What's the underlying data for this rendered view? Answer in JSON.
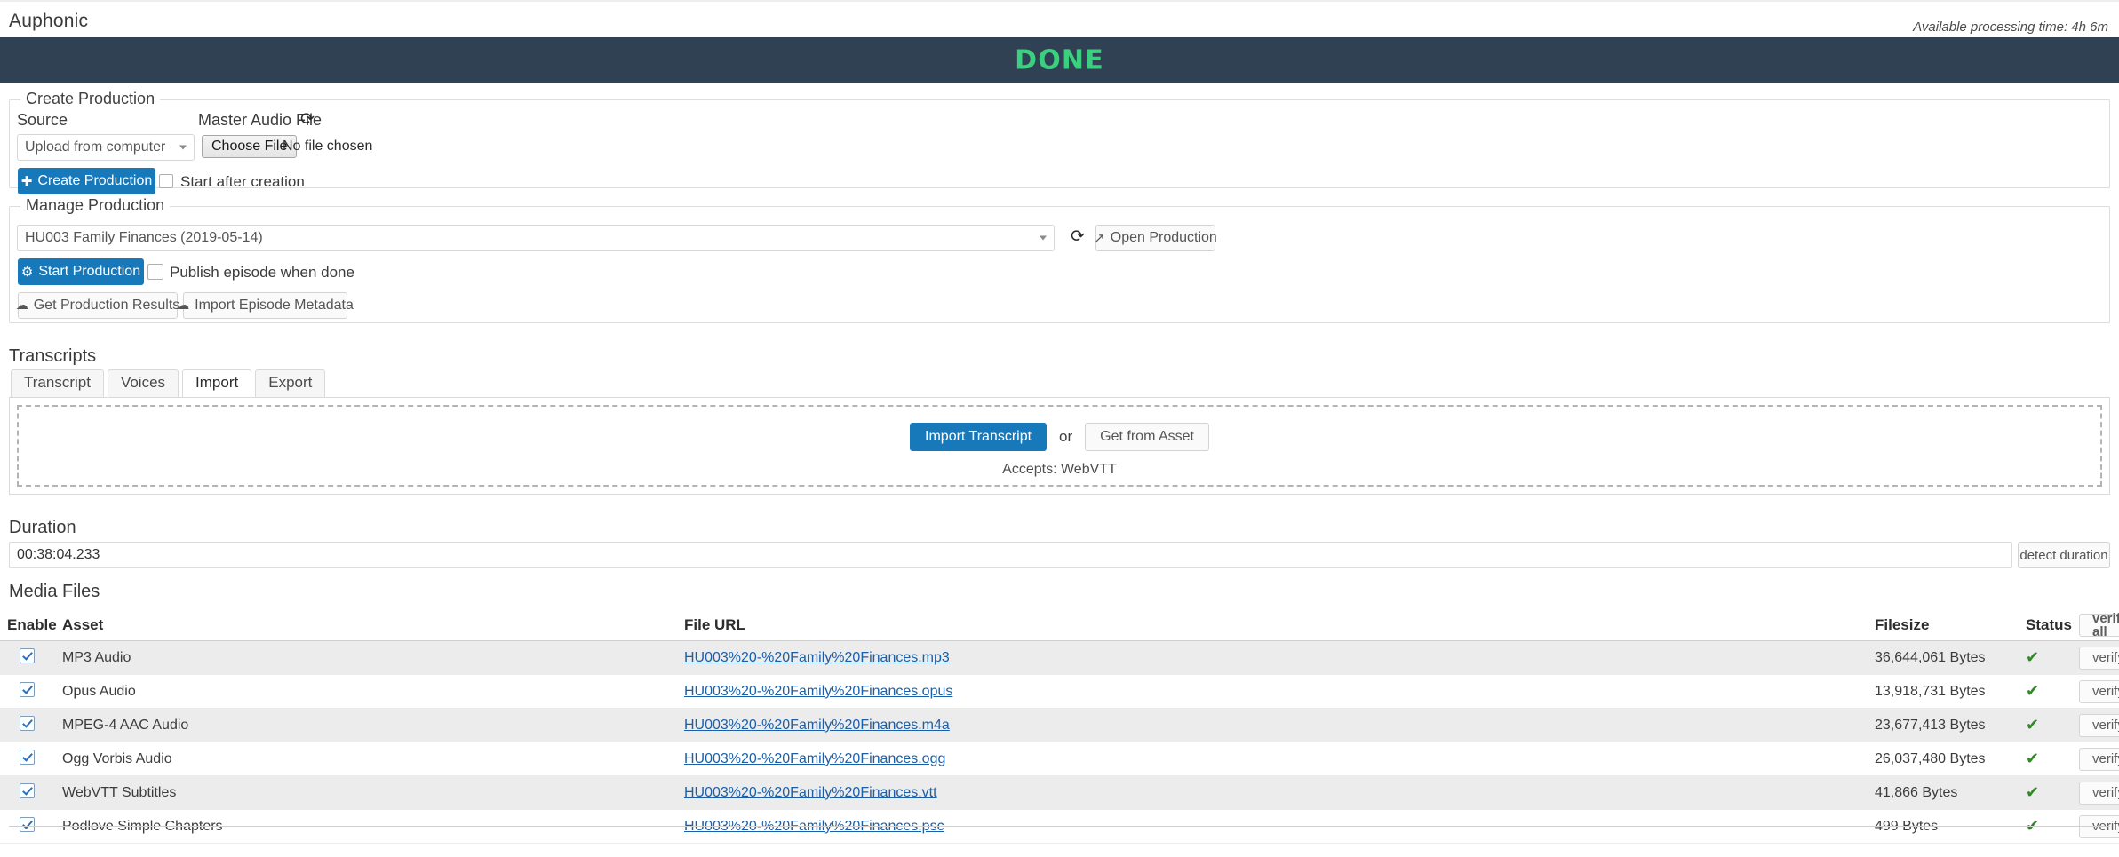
{
  "header": {
    "brand": "Auphonic",
    "processing_time": "Available processing time: 4h 6m",
    "status_banner": "DONE",
    "status_color": "#3ad07f",
    "banner_bg": "#2f4153"
  },
  "create_production": {
    "legend": "Create Production",
    "source_label": "Source",
    "source_value": "Upload from computer",
    "master_audio_label": "Master Audio File",
    "refresh_icon": "refresh-icon",
    "choose_file_label": "Choose File",
    "no_file_text": "No file chosen",
    "create_button": "Create Production",
    "create_button_icon": "plus-icon",
    "start_after_creation_label": "Start after creation",
    "start_after_creation_checked": false
  },
  "manage_production": {
    "legend": "Manage Production",
    "production_value": "HU003 Family Finances (2019-05-14)",
    "refresh_icon": "refresh-icon",
    "open_production_label": "Open Production",
    "open_production_icon": "external-link-icon",
    "start_production_label": "Start Production",
    "start_production_icon": "gears-icon",
    "publish_label": "Publish episode when done",
    "publish_checked": false,
    "get_results_label": "Get Production Results",
    "get_results_icon": "cloud-download-icon",
    "import_metadata_label": "Import Episode Metadata",
    "import_metadata_icon": "cloud-download-icon"
  },
  "transcripts": {
    "title": "Transcripts",
    "tabs": [
      {
        "label": "Transcript",
        "active": false
      },
      {
        "label": "Voices",
        "active": false
      },
      {
        "label": "Import",
        "active": true
      },
      {
        "label": "Export",
        "active": false
      }
    ],
    "import_button": "Import Transcript",
    "or_text": "or",
    "get_from_asset_button": "Get from Asset",
    "accepts_text": "Accepts: WebVTT"
  },
  "duration": {
    "title": "Duration",
    "value": "00:38:04.233",
    "detect_button": "detect duration"
  },
  "media_files": {
    "title": "Media Files",
    "verify_all_label": "verify all",
    "columns": [
      "Enable",
      "Asset",
      "File URL",
      "Filesize",
      "Status"
    ],
    "row_action_label": "verify",
    "status_icon": "check-icon",
    "rows": [
      {
        "enabled": true,
        "asset": "MP3 Audio",
        "url": "HU003%20-%20Family%20Finances.mp3",
        "filesize": "36,644,061 Bytes",
        "status": "✔"
      },
      {
        "enabled": true,
        "asset": "Opus Audio",
        "url": "HU003%20-%20Family%20Finances.opus",
        "filesize": "13,918,731 Bytes",
        "status": "✔"
      },
      {
        "enabled": true,
        "asset": "MPEG-4 AAC Audio",
        "url": "HU003%20-%20Family%20Finances.m4a",
        "filesize": "23,677,413 Bytes",
        "status": "✔"
      },
      {
        "enabled": true,
        "asset": "Ogg Vorbis Audio",
        "url": "HU003%20-%20Family%20Finances.ogg",
        "filesize": "26,037,480 Bytes",
        "status": "✔"
      },
      {
        "enabled": true,
        "asset": "WebVTT Subtitles",
        "url": "HU003%20-%20Family%20Finances.vtt",
        "filesize": "41,866 Bytes",
        "status": "✔"
      },
      {
        "enabled": true,
        "asset": "Podlove Simple Chapters",
        "url": "HU003%20-%20Family%20Finances.psc",
        "filesize": "499 Bytes",
        "status": "✔"
      }
    ]
  }
}
